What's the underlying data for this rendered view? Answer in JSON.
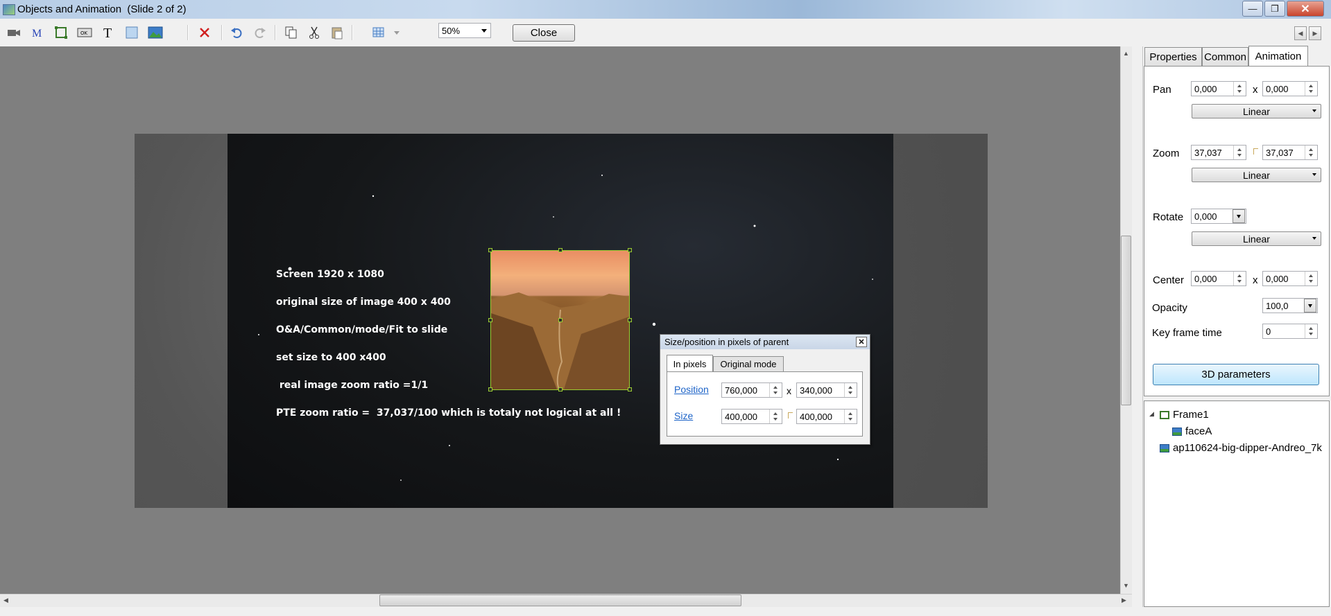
{
  "window": {
    "title": "Objects and Animation  (Slide 2 of 2)",
    "minimize_glyph": "—",
    "maximize_glyph": "❐",
    "close_glyph": "✕"
  },
  "toolbar": {
    "zoom_value": "50%",
    "close_label": "Close",
    "icons": [
      "camera-icon",
      "mask-icon",
      "frame-icon",
      "button-icon",
      "text-icon",
      "rectangle-icon",
      "image-icon",
      "delete-icon",
      "undo-icon",
      "redo-icon",
      "copy-icon",
      "cut-icon",
      "paste-icon",
      "grid-icon"
    ]
  },
  "slide": {
    "lines": [
      "Screen 1920 x 1080",
      "original size of image 400 x 400",
      "O&A/Common/mode/Fit to slide",
      "set size to 400 x400",
      " real image zoom ratio =1/1",
      "PTE zoom ratio =  37,037/100 which is totaly not logical at all !"
    ]
  },
  "dialog": {
    "title": "Size/position in pixels of parent",
    "tabs": [
      "In pixels",
      "Original mode"
    ],
    "position_label": "Position",
    "position_x": "760,000",
    "position_y": "340,000",
    "size_label": "Size",
    "size_w": "400,000",
    "size_h": "400,000",
    "x_sep": "x"
  },
  "right_panel": {
    "tabs": [
      "Properties",
      "Common",
      "Animation"
    ],
    "active_tab": "Animation",
    "pan": {
      "label": "Pan",
      "x": "0,000",
      "y": "0,000",
      "mode": "Linear"
    },
    "zoom": {
      "label": "Zoom",
      "x": "37,037",
      "y": "37,037",
      "mode": "Linear"
    },
    "rotate": {
      "label": "Rotate",
      "value": "0,000",
      "mode": "Linear"
    },
    "center": {
      "label": "Center",
      "x": "0,000",
      "y": "0,000"
    },
    "opacity": {
      "label": "Opacity",
      "value": "100,0"
    },
    "keyframe": {
      "label": "Key frame time",
      "value": "0"
    },
    "x_sep": "x",
    "button_3d": "3D parameters"
  },
  "tree": {
    "items": [
      {
        "label": "Frame1",
        "icon": "frame-icon"
      },
      {
        "label": "faceA",
        "icon": "image-icon"
      },
      {
        "label": "ap110624-big-dipper-Andreo_7k",
        "icon": "image-icon"
      }
    ]
  },
  "colors": {
    "workspace": "#7f7f7f",
    "selection": "#9acd32",
    "link": "#1e64c8"
  }
}
